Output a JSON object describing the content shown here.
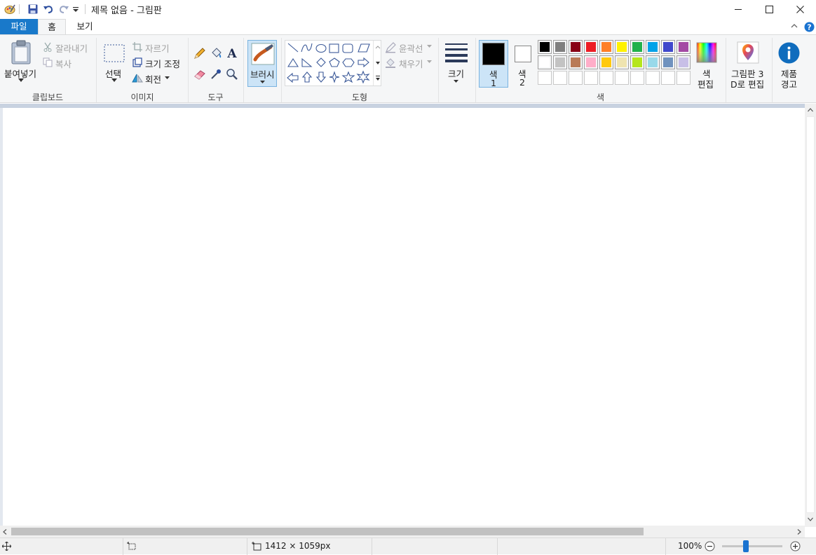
{
  "window": {
    "title": "제목 없음 - 그림판",
    "quick_access": [
      "paint-app-icon",
      "save-icon",
      "undo-icon",
      "redo-icon",
      "customize-dropdown-icon"
    ],
    "controls": [
      "minimize-icon",
      "maximize-icon",
      "close-icon"
    ]
  },
  "tabs": [
    {
      "label": "파일",
      "active": false
    },
    {
      "label": "홈",
      "active": true
    },
    {
      "label": "보기",
      "active": false
    }
  ],
  "ribbon": {
    "clipboard": {
      "group_label": "클립보드",
      "paste": "붙여넣기",
      "cut": "잘라내기",
      "copy": "복사"
    },
    "image": {
      "group_label": "이미지",
      "select": "선택",
      "crop": "자르기",
      "resize": "크기 조정",
      "rotate": "회전"
    },
    "tools": {
      "group_label": "도구",
      "items": [
        "pencil-icon",
        "fill-icon",
        "text-icon",
        "eraser-icon",
        "color-picker-icon",
        "magnifier-icon"
      ]
    },
    "brushes": {
      "label": "브러시"
    },
    "shapes": {
      "group_label": "도형",
      "outline": "윤곽선",
      "fill": "채우기"
    },
    "size": {
      "label": "크기"
    },
    "colors": {
      "group_label": "색",
      "color1_label": "색",
      "color1_num": "1",
      "color2_label": "색",
      "color2_num": "2",
      "color1": "#000000",
      "color2": "#ffffff",
      "palette_row1": [
        "#000000",
        "#7f7f7f",
        "#880015",
        "#ed1c24",
        "#ff7f27",
        "#fff200",
        "#22b14c",
        "#00a2e8",
        "#3f48cc",
        "#a349a4"
      ],
      "palette_row2": [
        "#ffffff",
        "#c3c3c3",
        "#b97a57",
        "#ffaec9",
        "#ffc90e",
        "#efe4b0",
        "#b5e61d",
        "#99d9ea",
        "#7092be",
        "#c8bfe7"
      ],
      "palette_row3": [
        "#ffffff",
        "#ffffff",
        "#ffffff",
        "#ffffff",
        "#ffffff",
        "#ffffff",
        "#ffffff",
        "#ffffff",
        "#ffffff",
        "#ffffff"
      ],
      "edit_colors_1": "색",
      "edit_colors_2": "편집"
    },
    "paint3d": {
      "line1": "그림판 3",
      "line2": "D로 편집"
    },
    "product_alert": {
      "line1": "제품",
      "line2": "경고"
    }
  },
  "status": {
    "image_size": "1412 × 1059px",
    "zoom": "100%"
  }
}
